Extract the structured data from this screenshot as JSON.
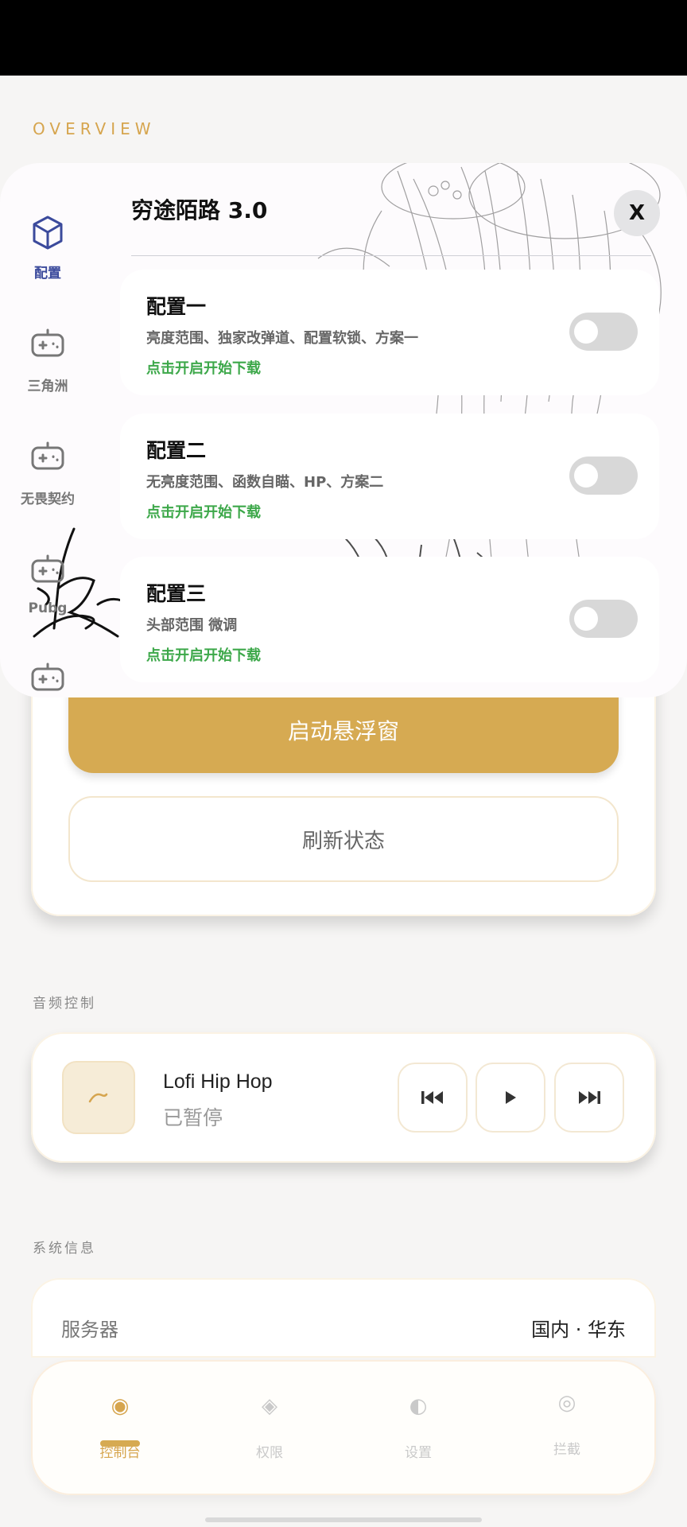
{
  "overview_label": "OVERVIEW",
  "main": {
    "start_button": "启动悬浮窗",
    "refresh_button": "刷新状态"
  },
  "audio": {
    "section_label": "音频控制",
    "track_title": "Lofi Hip Hop",
    "track_status": "已暂停"
  },
  "system": {
    "section_label": "系统信息",
    "server_label": "服务器",
    "server_value": "国内 · 华东"
  },
  "bottom_nav": [
    {
      "label": "控制台",
      "icon": "target-icon",
      "active": true
    },
    {
      "label": "权限",
      "icon": "diamond-icon",
      "active": false
    },
    {
      "label": "设置",
      "icon": "half-circle-icon",
      "active": false
    },
    {
      "label": "拦截",
      "icon": "ring-icon",
      "active": false
    }
  ],
  "popup": {
    "title": "穷途陌路 3.0",
    "close_label": "X",
    "sidebar": [
      {
        "label": "配置",
        "icon": "cube-icon",
        "active": true
      },
      {
        "label": "三角洲",
        "icon": "gamepad-icon",
        "active": false
      },
      {
        "label": "无畏契约",
        "icon": "gamepad-icon",
        "active": false
      },
      {
        "label": "Pubg",
        "icon": "gamepad-icon",
        "active": false
      },
      {
        "label": "",
        "icon": "gamepad-icon",
        "active": false
      }
    ],
    "configs": [
      {
        "title": "配置一",
        "desc": "亮度范围、独家改弹道、配置软锁、方案一",
        "link": "点击开启开始下载",
        "enabled": false
      },
      {
        "title": "配置二",
        "desc": "无亮度范围、函数自瞄、HP、方案二",
        "link": "点击开启开始下载",
        "enabled": false
      },
      {
        "title": "配置三",
        "desc": "头部范围 微调",
        "link": "点击开启开始下载",
        "enabled": false
      }
    ]
  },
  "colors": {
    "accent": "#d6aa52",
    "link_green": "#3da84a",
    "sidebar_active": "#3b4a9c"
  }
}
